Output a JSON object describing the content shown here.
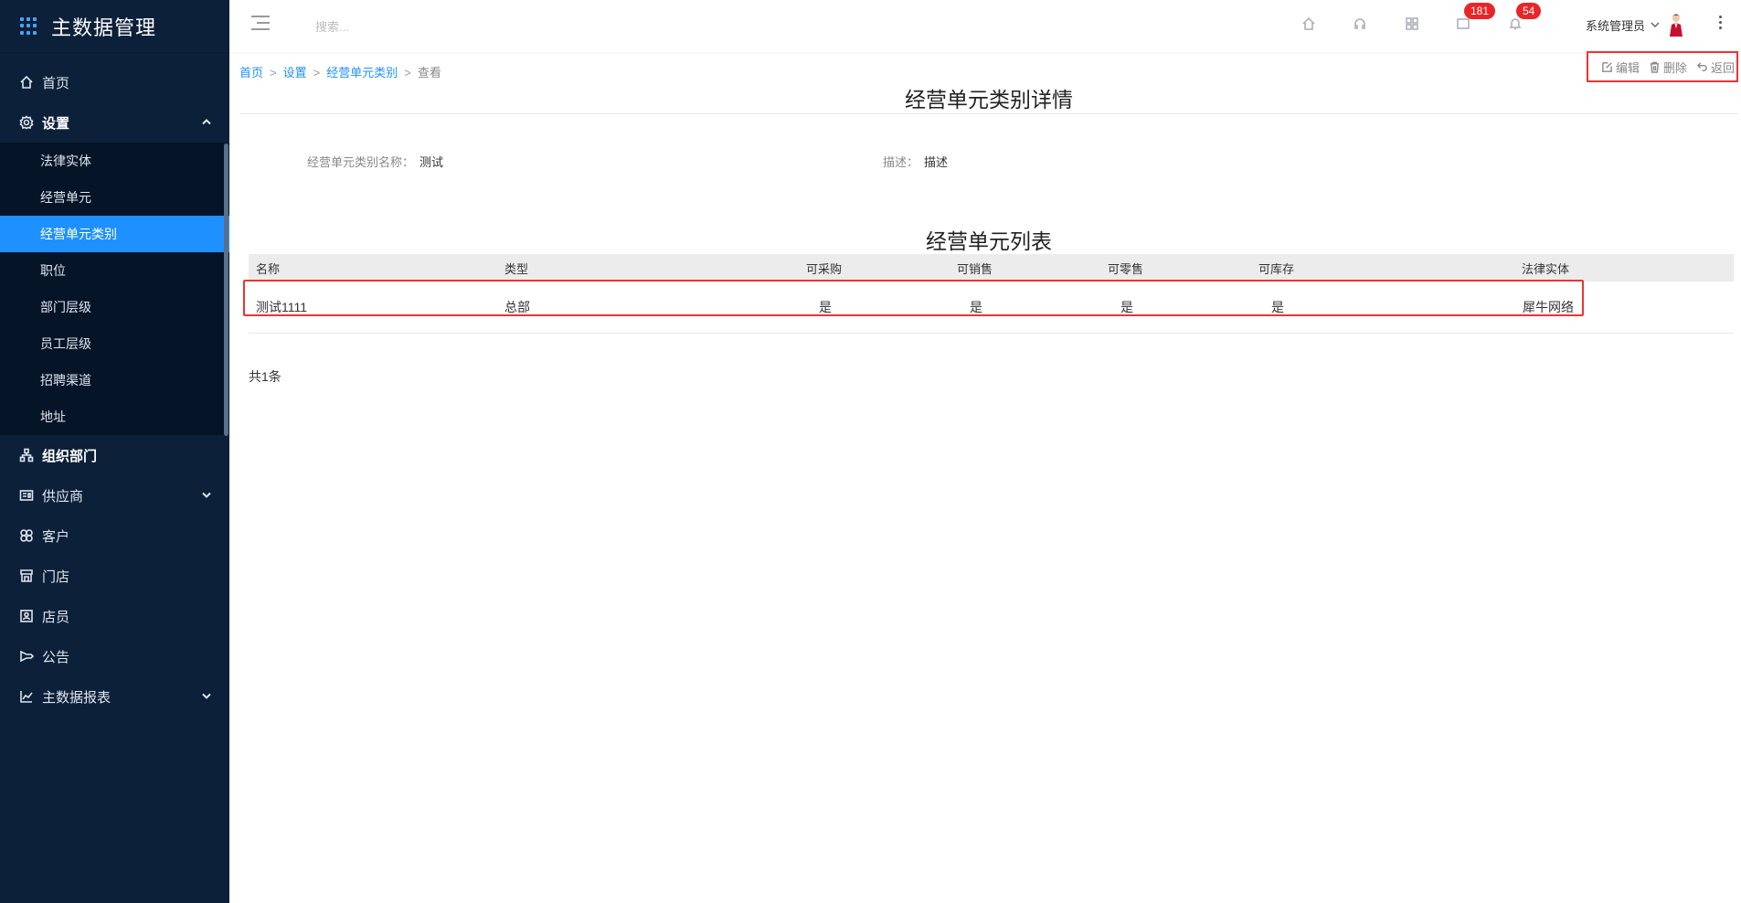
{
  "app": {
    "title": "主数据管理"
  },
  "sidebar": {
    "items": [
      {
        "label": "首页",
        "icon": "home-icon"
      },
      {
        "label": "设置",
        "icon": "gear-icon",
        "expanded": true,
        "children": [
          {
            "label": "法律实体"
          },
          {
            "label": "经营单元"
          },
          {
            "label": "经营单元类别",
            "active": true
          },
          {
            "label": "职位"
          },
          {
            "label": "部门层级"
          },
          {
            "label": "员工层级"
          },
          {
            "label": "招聘渠道"
          },
          {
            "label": "地址"
          }
        ]
      },
      {
        "label": "组织部门",
        "icon": "org-tree-icon"
      },
      {
        "label": "供应商",
        "icon": "supplier-icon"
      },
      {
        "label": "客户",
        "icon": "customer-icon"
      },
      {
        "label": "门店",
        "icon": "store-icon"
      },
      {
        "label": "店员",
        "icon": "staff-icon"
      },
      {
        "label": "公告",
        "icon": "announcement-icon"
      },
      {
        "label": "主数据报表",
        "icon": "report-chart-icon"
      }
    ]
  },
  "header": {
    "search_placeholder": "搜索...",
    "badges": {
      "messages": "181",
      "notifications": "54"
    },
    "user_name": "系统管理员"
  },
  "breadcrumb": [
    "首页",
    "设置",
    "经营单元类别",
    "查看"
  ],
  "actions": {
    "edit": "编辑",
    "delete": "删除",
    "back": "返回"
  },
  "detail": {
    "title": "经营单元类别详情",
    "fields": [
      {
        "label": "经营单元类别名称：",
        "value": "测试"
      },
      {
        "label": "描述：",
        "value": "描述"
      }
    ]
  },
  "list": {
    "title": "经营单元列表",
    "columns": [
      "名称",
      "类型",
      "可采购",
      "可销售",
      "可零售",
      "可库存",
      "法律实体"
    ],
    "rows": [
      [
        "测试1111",
        "总部",
        "是",
        "是",
        "是",
        "是",
        "犀牛网络"
      ]
    ],
    "total": "共1条"
  },
  "colors": {
    "sidebar_bg": "#0c2039",
    "active": "#1e90ff",
    "highlight": "#e33333",
    "badge": "#e8262a"
  }
}
